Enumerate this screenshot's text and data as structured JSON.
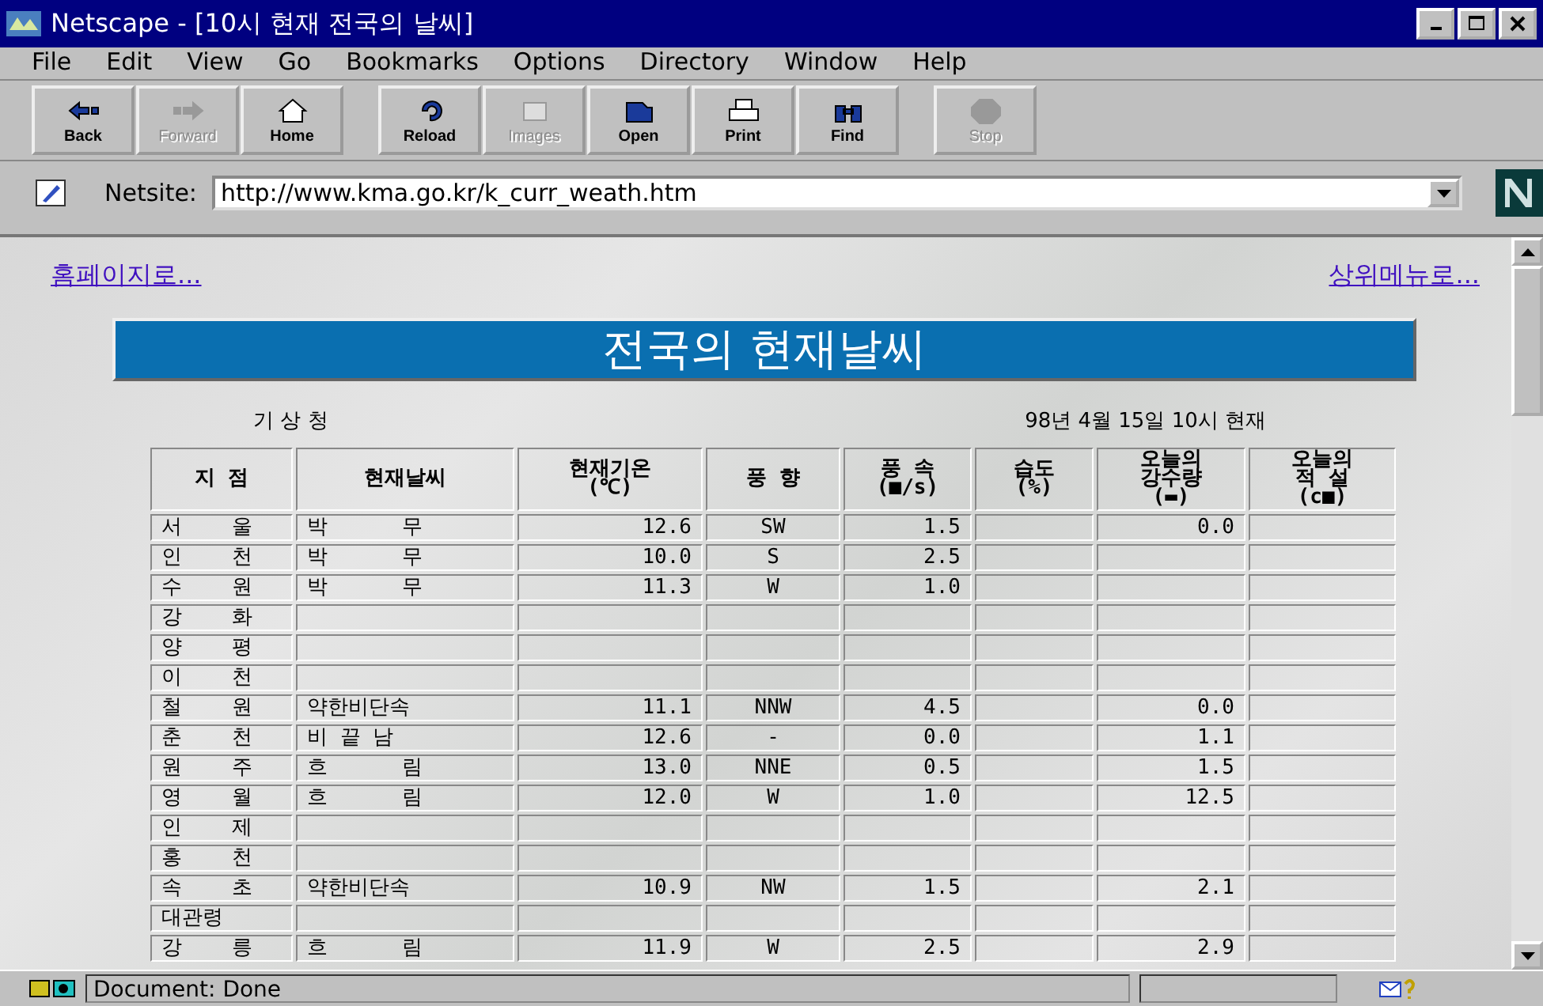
{
  "window": {
    "title": "Netscape - [10시 현재 전국의 날씨]"
  },
  "menu": [
    "File",
    "Edit",
    "View",
    "Go",
    "Bookmarks",
    "Options",
    "Directory",
    "Window",
    "Help"
  ],
  "toolbar": [
    {
      "label": "Back",
      "kind": "back",
      "disabled": false
    },
    {
      "label": "Forward",
      "kind": "forward",
      "disabled": true
    },
    {
      "label": "Home",
      "kind": "home",
      "disabled": false
    },
    {
      "label": "Reload",
      "kind": "reload",
      "disabled": false
    },
    {
      "label": "Images",
      "kind": "images",
      "disabled": true
    },
    {
      "label": "Open",
      "kind": "open",
      "disabled": false
    },
    {
      "label": "Print",
      "kind": "print",
      "disabled": false
    },
    {
      "label": "Find",
      "kind": "find",
      "disabled": false
    },
    {
      "label": "Stop",
      "kind": "stop",
      "disabled": true
    }
  ],
  "location": {
    "label": "Netsite:",
    "value": "http://www.kma.go.kr/k_curr_weath.htm"
  },
  "page": {
    "links": [
      "홈페이지로...",
      "상위메뉴로..."
    ],
    "banner": "전국의 현재날씨",
    "source": "기 상 청",
    "timestamp": "98년   4월  15일  10시  현재",
    "table": {
      "columns": [
        "지    점",
        "현재날씨",
        "현재기온\n(℃)",
        "풍  향",
        "풍 속\n(■/s)",
        "습도\n(%)",
        "오늘의\n강수량\n(▬)",
        "오늘의\n적  설\n(c■)"
      ],
      "rows": [
        [
          "서    울",
          "박      무",
          "12.6",
          "SW",
          "1.5",
          "",
          "0.0",
          ""
        ],
        [
          "인    천",
          "박      무",
          "10.0",
          "S",
          "2.5",
          "",
          "",
          ""
        ],
        [
          "수    원",
          "박      무",
          "11.3",
          "W",
          "1.0",
          "",
          "",
          ""
        ],
        [
          "강    화",
          "",
          "",
          "",
          "",
          "",
          "",
          ""
        ],
        [
          "양    평",
          "",
          "",
          "",
          "",
          "",
          "",
          ""
        ],
        [
          "이    천",
          "",
          "",
          "",
          "",
          "",
          "",
          ""
        ],
        [
          "철    원",
          "약한비단속",
          "11.1",
          "NNW",
          "4.5",
          "",
          "0.0",
          ""
        ],
        [
          "춘    천",
          "비 끝 남",
          "12.6",
          "-",
          "0.0",
          "",
          "1.1",
          ""
        ],
        [
          "원    주",
          "흐      림",
          "13.0",
          "NNE",
          "0.5",
          "",
          "1.5",
          ""
        ],
        [
          "영    월",
          "흐      림",
          "12.0",
          "W",
          "1.0",
          "",
          "12.5",
          ""
        ],
        [
          "인    제",
          "",
          "",
          "",
          "",
          "",
          "",
          ""
        ],
        [
          "홍    천",
          "",
          "",
          "",
          "",
          "",
          "",
          ""
        ],
        [
          "속    초",
          "약한비단속",
          "10.9",
          "NW",
          "1.5",
          "",
          "2.1",
          ""
        ],
        [
          "대관령",
          "",
          "",
          "",
          "",
          "",
          "",
          ""
        ],
        [
          "강    릉",
          "흐      림",
          "11.9",
          "W",
          "2.5",
          "",
          "2.9",
          ""
        ]
      ]
    }
  },
  "status_bar": {
    "text": "Document: Done"
  }
}
